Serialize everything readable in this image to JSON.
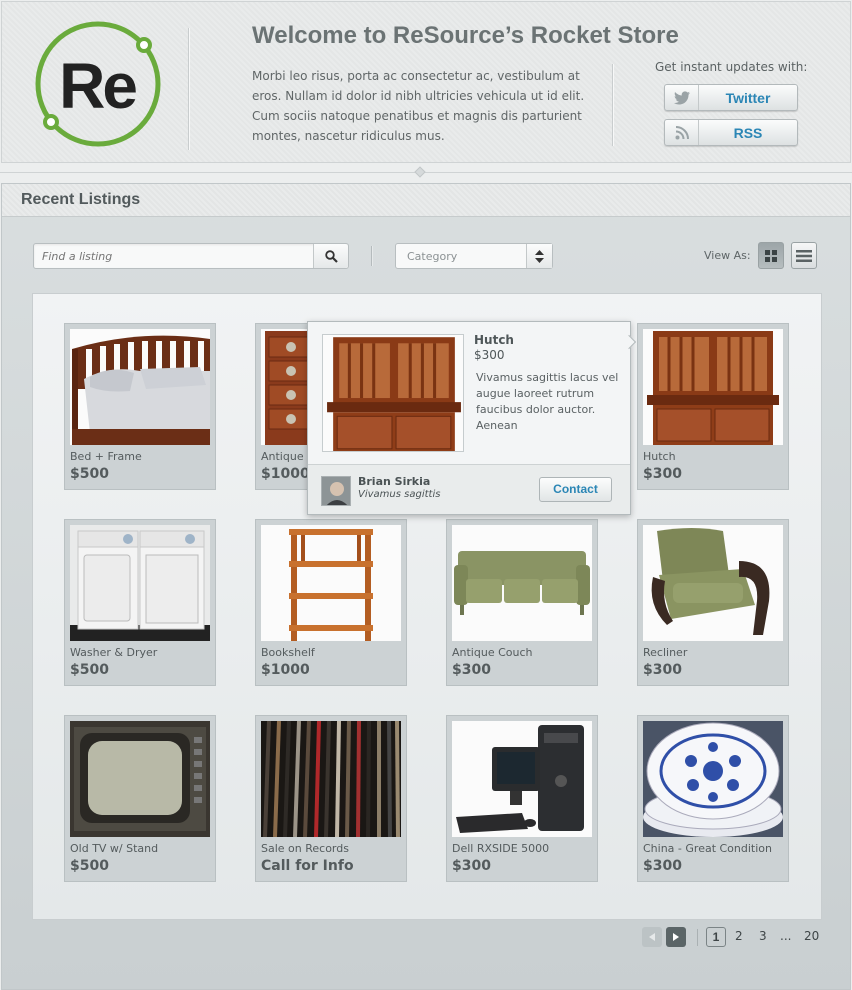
{
  "header": {
    "logo_text": "Re",
    "title": "Welcome to ReSource’s Rocket Store",
    "intro": "Morbi leo risus, porta ac consectetur ac, vestibulum at eros. Nullam id dolor id nibh ultricies vehicula ut id elit. Cum sociis natoque penatibus et magnis dis parturient montes, nascetur ridiculus mus.",
    "updates_label": "Get instant updates with:",
    "twitter_label": "Twitter",
    "rss_label": "RSS",
    "accent_color": "#6aab3c",
    "link_color": "#2b86b5"
  },
  "main": {
    "title": "Recent Listings",
    "search_placeholder": "Find a listing",
    "category_value": "Category",
    "view_as_label": "View As:",
    "active_view": "grid"
  },
  "listings": [
    {
      "name": "Bed + Frame",
      "price": "$500",
      "icon": "bed"
    },
    {
      "name": "Antique Dresser",
      "price": "$1000",
      "icon": "dresser"
    },
    {
      "name": "Hutch",
      "price": "$300",
      "icon": "hutch"
    },
    {
      "name": "Hutch",
      "price": "$300",
      "icon": "hutch"
    },
    {
      "name": "Washer & Dryer",
      "price": "$500",
      "icon": "washer"
    },
    {
      "name": "Bookshelf",
      "price": "$1000",
      "icon": "bookshelf"
    },
    {
      "name": "Antique Couch",
      "price": "$300",
      "icon": "couch"
    },
    {
      "name": "Recliner",
      "price": "$300",
      "icon": "recliner"
    },
    {
      "name": "Old TV w/ Stand",
      "price": "$500",
      "icon": "tv"
    },
    {
      "name": "Sale on Records",
      "price": "Call for Info",
      "icon": "records"
    },
    {
      "name": "Dell RXSIDE 5000",
      "price": "$300",
      "icon": "computer"
    },
    {
      "name": "China - Great Condition",
      "price": "$300",
      "icon": "china"
    }
  ],
  "popup": {
    "title": "Hutch",
    "price": "$300",
    "description": "Vivamus sagittis lacus vel augue laoreet rutrum faucibus dolor auctor. Aenean",
    "seller_name": "Brian Sirkia",
    "seller_sub": "Vivamus sagittis",
    "contact_label": "Contact"
  },
  "pagination": {
    "current": "1",
    "pages": [
      "2",
      "3"
    ],
    "ellipsis": "...",
    "last": "20"
  }
}
